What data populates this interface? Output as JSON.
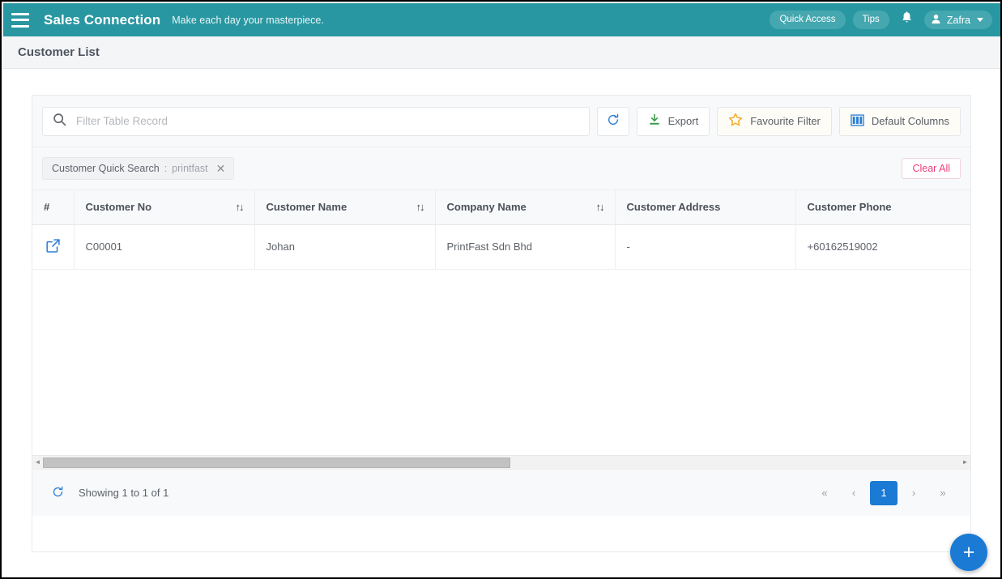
{
  "header": {
    "menu_icon": "hamburger-icon",
    "brand": "Sales Connection",
    "tagline": "Make each day your masterpiece.",
    "quick_access_label": "Quick Access",
    "tips_label": "Tips",
    "bell_icon": "bell-icon",
    "user_icon": "user-icon",
    "user_name": "Zafra",
    "caret_icon": "chevron-down-icon",
    "teal": "#2897a1",
    "pill_bg": "#45a7af"
  },
  "page": {
    "title": "Customer List"
  },
  "toolbar": {
    "search_placeholder": "Filter Table Record",
    "search_value": "",
    "search_icon": "search-icon",
    "refresh_icon": "refresh-icon",
    "export_label": "Export",
    "export_icon": "download-icon",
    "favourite_label": "Favourite Filter",
    "favourite_icon": "star-icon",
    "columns_label": "Default Columns",
    "columns_icon": "columns-icon"
  },
  "filters": {
    "chip_label": "Customer Quick Search",
    "chip_separator": ":",
    "chip_value": "printfast",
    "chip_close_icon": "close-icon",
    "clear_all_label": "Clear All"
  },
  "table": {
    "columns": [
      {
        "label": "#",
        "sortable": false
      },
      {
        "label": "Customer No",
        "sortable": true
      },
      {
        "label": "Customer Name",
        "sortable": true
      },
      {
        "label": "Company Name",
        "sortable": true
      },
      {
        "label": "Customer Address",
        "sortable": false
      },
      {
        "label": "Customer Phone",
        "sortable": false
      }
    ],
    "rows": [
      {
        "open_icon": "open-in-new-icon",
        "customer_no": "C00001",
        "customer_name": "Johan",
        "company_name": "PrintFast Sdn Bhd",
        "customer_address": "-",
        "customer_phone": "+60162519002"
      }
    ],
    "sort_icon": "sort-updown-icon"
  },
  "scrollbar": {
    "left_arrow_icon": "chevron-left-icon",
    "right_arrow_icon": "chevron-right-icon",
    "thumb_width_percent": 51
  },
  "footer": {
    "refresh_icon": "refresh-icon",
    "showing_text": "Showing 1 to 1 of 1",
    "pagination": {
      "first_label": "«",
      "prev_label": "‹",
      "current_page": "1",
      "next_label": "›",
      "last_label": "»",
      "active_color": "#1a7ad4"
    }
  },
  "fab": {
    "label": "+",
    "icon": "plus-icon",
    "color": "#1a7ad4"
  }
}
